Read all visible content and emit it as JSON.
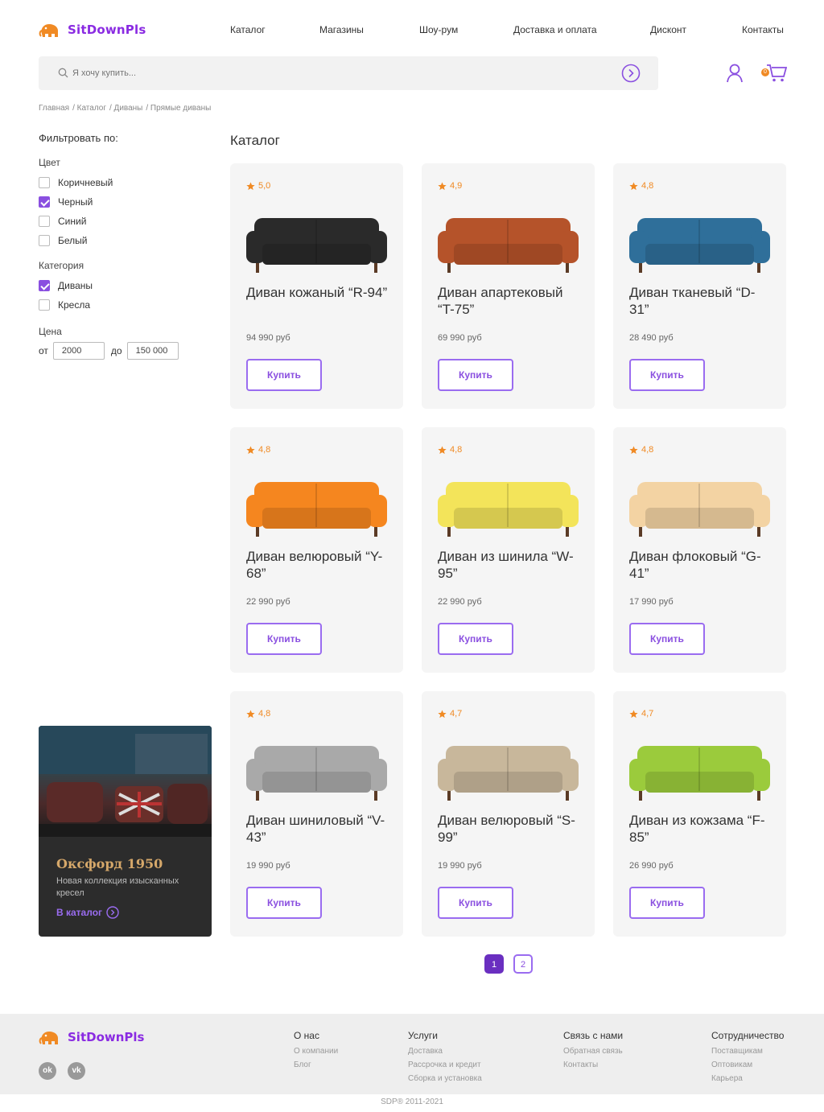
{
  "brand": {
    "name": "SitDownPls",
    "accent": "#8a2be2",
    "logo_icon": "elephant-icon"
  },
  "nav": [
    {
      "label": "Каталог"
    },
    {
      "label": "Магазины"
    },
    {
      "label": "Шоу-рум"
    },
    {
      "label": "Доставка и оплата"
    },
    {
      "label": "Дисконт"
    },
    {
      "label": "Контакты"
    }
  ],
  "search": {
    "placeholder": "Я хочу купить..."
  },
  "cart": {
    "count": "0"
  },
  "breadcrumb": [
    "Главная",
    "/ Каталог",
    "/ Диваны",
    "/ Прямые диваны"
  ],
  "filters": {
    "title": "Фильтровать по:",
    "color_label": "Цвет",
    "colors": [
      {
        "label": "Коричневый",
        "checked": false
      },
      {
        "label": "Черный",
        "checked": true
      },
      {
        "label": "Синий",
        "checked": false
      },
      {
        "label": "Белый",
        "checked": false
      }
    ],
    "category_label": "Категория",
    "categories": [
      {
        "label": "Диваны",
        "checked": true
      },
      {
        "label": "Кресла",
        "checked": false
      }
    ],
    "price_label": "Цена",
    "price_from_label": "от",
    "price_from": "2000",
    "price_to_label": "до",
    "price_to": "150 000"
  },
  "promo": {
    "title": "Оксфорд 1950",
    "description": "Новая коллекция изысканных кресел",
    "link": "В каталог"
  },
  "catalog": {
    "title": "Каталог",
    "buy_label": "Купить",
    "products": [
      {
        "rating": "5,0",
        "name": "Диван кожаный “R-94”",
        "price": "94 990 руб",
        "color": "#2a2a2a"
      },
      {
        "rating": "4,9",
        "name": "Диван апартековый “T-75”",
        "price": "69 990 руб",
        "color": "#b5532a"
      },
      {
        "rating": "4,8",
        "name": "Диван тканевый “D-31”",
        "price": "28 490 руб",
        "color": "#2f6f9a"
      },
      {
        "rating": "4,8",
        "name": "Диван велюровый “Y-68”",
        "price": "22 990 руб",
        "color": "#f5861f"
      },
      {
        "rating": "4,8",
        "name": "Диван из шинила “W-95”",
        "price": "22 990 руб",
        "color": "#f3e45a"
      },
      {
        "rating": "4,8",
        "name": "Диван флоковый “G-41”",
        "price": "17 990 руб",
        "color": "#f3d3a3"
      },
      {
        "rating": "4,8",
        "name": "Диван шиниловый “V-43”",
        "price": "19 990 руб",
        "color": "#a9a9a9"
      },
      {
        "rating": "4,7",
        "name": "Диван велюровый “S-99”",
        "price": "19 990 руб",
        "color": "#c8b79b"
      },
      {
        "rating": "4,7",
        "name": "Диван из кожзама “F-85”",
        "price": "26 990 руб",
        "color": "#9bcb3c"
      }
    ]
  },
  "pagination": {
    "pages": [
      "1",
      "2"
    ],
    "active": "1"
  },
  "footer": {
    "social": [
      {
        "icon": "odnoklassniki-icon",
        "glyph": "ok"
      },
      {
        "icon": "vk-icon",
        "glyph": "vk"
      }
    ],
    "columns": [
      {
        "title": "О нас",
        "links": [
          "О компании",
          "Блог"
        ]
      },
      {
        "title": "Услуги",
        "links": [
          "Доставка",
          "Рассрочка и кредит",
          "Сборка и установка"
        ]
      },
      {
        "title": "Связь с нами",
        "links": [
          "Обратная связь",
          "Контакты"
        ]
      },
      {
        "title": "Сотрудничество",
        "links": [
          "Поставщикам",
          "Оптовикам",
          "Карьера"
        ]
      }
    ],
    "copyright": "SDP®   2011-2021"
  }
}
